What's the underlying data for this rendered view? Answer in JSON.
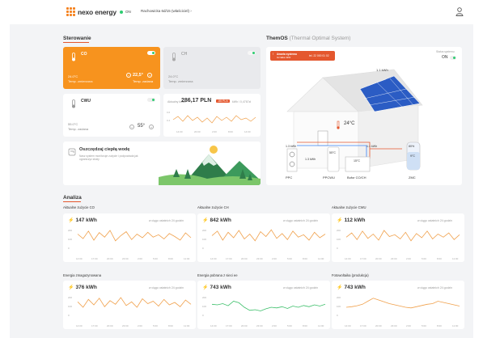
{
  "header": {
    "brand": "nexo energy",
    "status_label": "ON",
    "address": "Rachowicka 6d/15 (właściciel)",
    "address_chevron": "›"
  },
  "control": {
    "title": "Sterowanie",
    "co": {
      "label": "CO",
      "temp_current": "24.0°C",
      "temp_current_label": "Temp. zmierzona",
      "setpoint": "22,5°",
      "setpoint_label": "Temp. zadana"
    },
    "ch": {
      "label": "CH",
      "temp_current": "24.0°C",
      "temp_current_label": "Temp. zmierzona"
    },
    "cwu": {
      "label": "CWU",
      "temp_current": "55.0°C",
      "temp_current_label": "Temp. zadana",
      "setpoint": "55°"
    },
    "cost": {
      "label": "Aktualny koszt",
      "value": "286,17 PLN",
      "badge": "-55 PLN",
      "sub": "kWh / 0,4767zł"
    },
    "cost_chart": {
      "x_labels": [
        "14:00",
        "20:00",
        "2:00",
        "8:00",
        "14:00"
      ],
      "y_labels": [
        "0.6",
        "0.4"
      ]
    },
    "promo": {
      "title": "Oszczędzaj ciepłą wodę",
      "text": "Nasz system monitoruje zużycie i podpowiada jak ograniczyć straty"
    }
  },
  "thermos": {
    "title": "ThemOS",
    "subtitle": "(Thermal Optimal System)",
    "alert_title": "Awaria systemu",
    "alert_sub": "Grzałka 3kW",
    "alert_right": "tel. 22 000 01 02",
    "system_status_label": "Status systemu",
    "system_status_value": "ON",
    "indoor_temp": "24°C",
    "pv_power": "1.1 kWh",
    "pipe_power": "1.1 kWh",
    "left_power": "1.3 kWh",
    "pump_power": "1.3 kWh",
    "tank_temp": "55°C",
    "buffer_temp": "15°C",
    "zmc_pct": "80%",
    "zmc_temp": "9°C",
    "labels": {
      "ppc": "PPC",
      "ppcwu": "PPCWU",
      "buffer": "Bufor CO/CH",
      "zmc": "ZMC"
    }
  },
  "analysis": {
    "title": "Analiza",
    "x_labels": [
      "14:00",
      "17:00",
      "20:00",
      "23:00",
      "2:00",
      "5:00",
      "8:00",
      "11:00"
    ],
    "y_labels": [
      "200",
      "100",
      "0"
    ],
    "note": "w ciągu ostatnich 24 godzin",
    "cards": [
      {
        "title": "Aktualne zużycie CO",
        "value": "147 kWh",
        "color": "#f0a04b"
      },
      {
        "title": "Aktualne zużycie CH",
        "value": "842 kWh",
        "color": "#f0a04b"
      },
      {
        "title": "Aktualne zużycie CWU",
        "value": "112 kWh",
        "color": "#f0a04b"
      },
      {
        "title": "Energia zmagazynowana",
        "value": "376 kWh",
        "color": "#f0a04b"
      },
      {
        "title": "Energia pobrana z sieci ee",
        "value": "743 kWh",
        "color": "#3cbf6a"
      },
      {
        "title": "Fotowoltaika (produkcja)",
        "value": "743 kWh",
        "color": "#f0a04b"
      }
    ]
  }
}
